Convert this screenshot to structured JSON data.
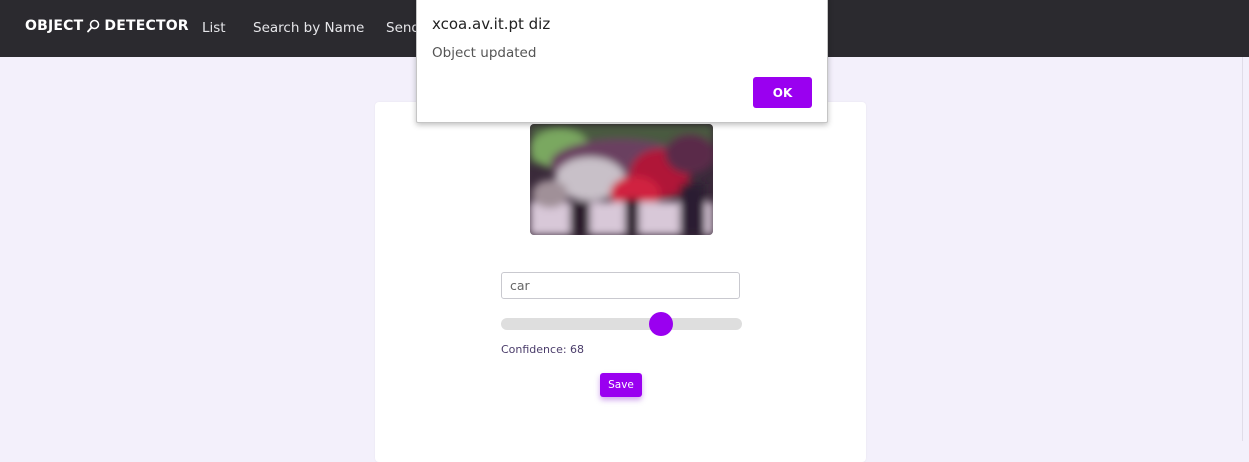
{
  "navbar": {
    "brand_left": "OBJECT",
    "brand_right": "DETECTOR",
    "links": [
      "List",
      "Search by Name",
      "Send"
    ]
  },
  "dialog": {
    "origin": "xcoa.av.it.pt diz",
    "message": "Object updated",
    "ok_label": "OK"
  },
  "form": {
    "name_value": "car",
    "confidence_label": "Confidence: 68",
    "confidence_value": 68,
    "save_label": "Save"
  },
  "colors": {
    "accent": "#9a00f0",
    "navbar_bg": "#2b2a2f",
    "page_bg": "#f3f0fb"
  }
}
